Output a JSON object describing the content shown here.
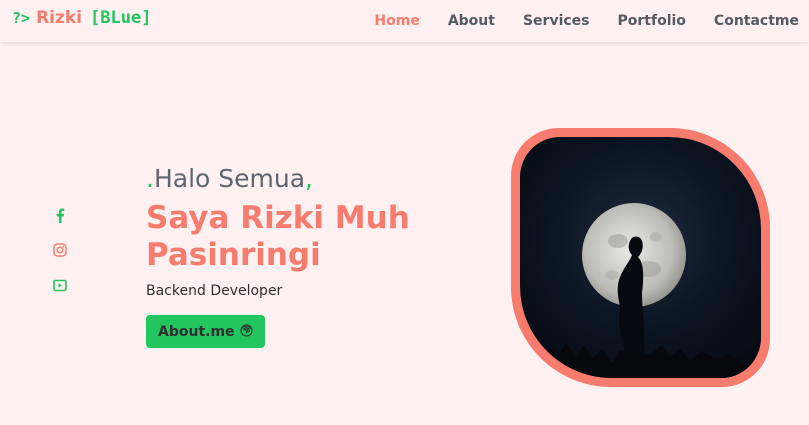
{
  "brand": {
    "symbol": "?>",
    "name": "Rizki",
    "tag": "[BLue]"
  },
  "nav": {
    "items": [
      {
        "label": "Home",
        "active": true
      },
      {
        "label": "About",
        "active": false
      },
      {
        "label": "Services",
        "active": false
      },
      {
        "label": "Portfolio",
        "active": false
      },
      {
        "label": "Contactme",
        "active": false
      }
    ]
  },
  "socials": [
    {
      "icon": "facebook-icon"
    },
    {
      "icon": "instagram-icon"
    },
    {
      "icon": "youtube-icon"
    }
  ],
  "hero": {
    "greeting_dot": ".",
    "greeting": "Halo Semua",
    "greeting_comma": ",",
    "name": "Saya Rizki Muh Pasinringi",
    "role": "Backend Developer",
    "button_label": "About.me",
    "button_icon": "fingerprint-icon"
  },
  "colors": {
    "accent": "#f87c6e",
    "green": "#22c55e",
    "background": "#fff0f1",
    "text": "#5f6670"
  }
}
